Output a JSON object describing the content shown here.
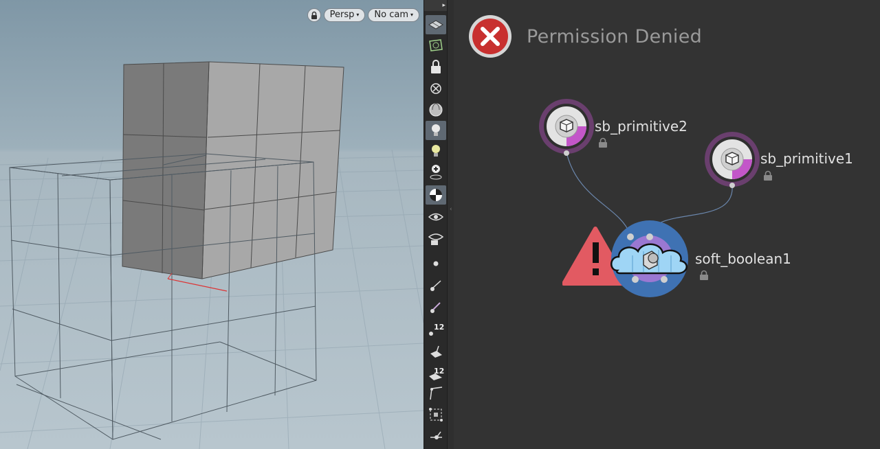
{
  "viewport": {
    "camera_mode": "Persp",
    "camera_name": "No cam",
    "lock_icon": "lock-icon"
  },
  "toolbar": {
    "top_arrow": "▸",
    "tools": [
      {
        "icon": "display-options-icon",
        "active": true
      },
      {
        "icon": "snapping-icon",
        "active": false
      },
      {
        "icon": "lock-view-icon",
        "active": false
      },
      {
        "icon": "ghost-other-objects-icon",
        "active": false
      },
      {
        "icon": "shading-sphere-icon",
        "active": false
      },
      {
        "icon": "lighting-icon",
        "active": true
      },
      {
        "icon": "headlight-icon",
        "active": false
      },
      {
        "icon": "add-light-icon",
        "active": false
      },
      {
        "icon": "shading-mode-icon",
        "active": true
      },
      {
        "icon": "visibility-icon",
        "active": false
      },
      {
        "icon": "camera-visibility-icon",
        "active": false
      },
      {
        "icon": "point-icon",
        "active": false
      },
      {
        "icon": "point-normal-icon",
        "active": false
      },
      {
        "icon": "point-marker-icon",
        "active": false
      },
      {
        "icon": "point-number-icon",
        "active": false,
        "label": "12"
      },
      {
        "icon": "primitive-normal-icon",
        "active": false
      },
      {
        "icon": "primitive-number-icon",
        "active": false,
        "label": "12"
      },
      {
        "icon": "vertex-icon",
        "active": false
      },
      {
        "icon": "hull-icon",
        "active": false
      },
      {
        "icon": "pivot-icon",
        "active": false
      }
    ]
  },
  "network": {
    "error_title": "Permission Denied",
    "nodes": [
      {
        "name": "sb_primitive2"
      },
      {
        "name": "sb_primitive1"
      },
      {
        "name": "soft_boolean1"
      }
    ],
    "colors": {
      "background": "#333333",
      "node_ring": "#6a3f6e",
      "node_accent": "#c356c9",
      "boolean_outer": "#3f72b3",
      "boolean_inner": "#9a78d2",
      "cloud_fill": "#9fd5f5",
      "warning": "#e25a62",
      "wire": "#6b87ad"
    }
  }
}
